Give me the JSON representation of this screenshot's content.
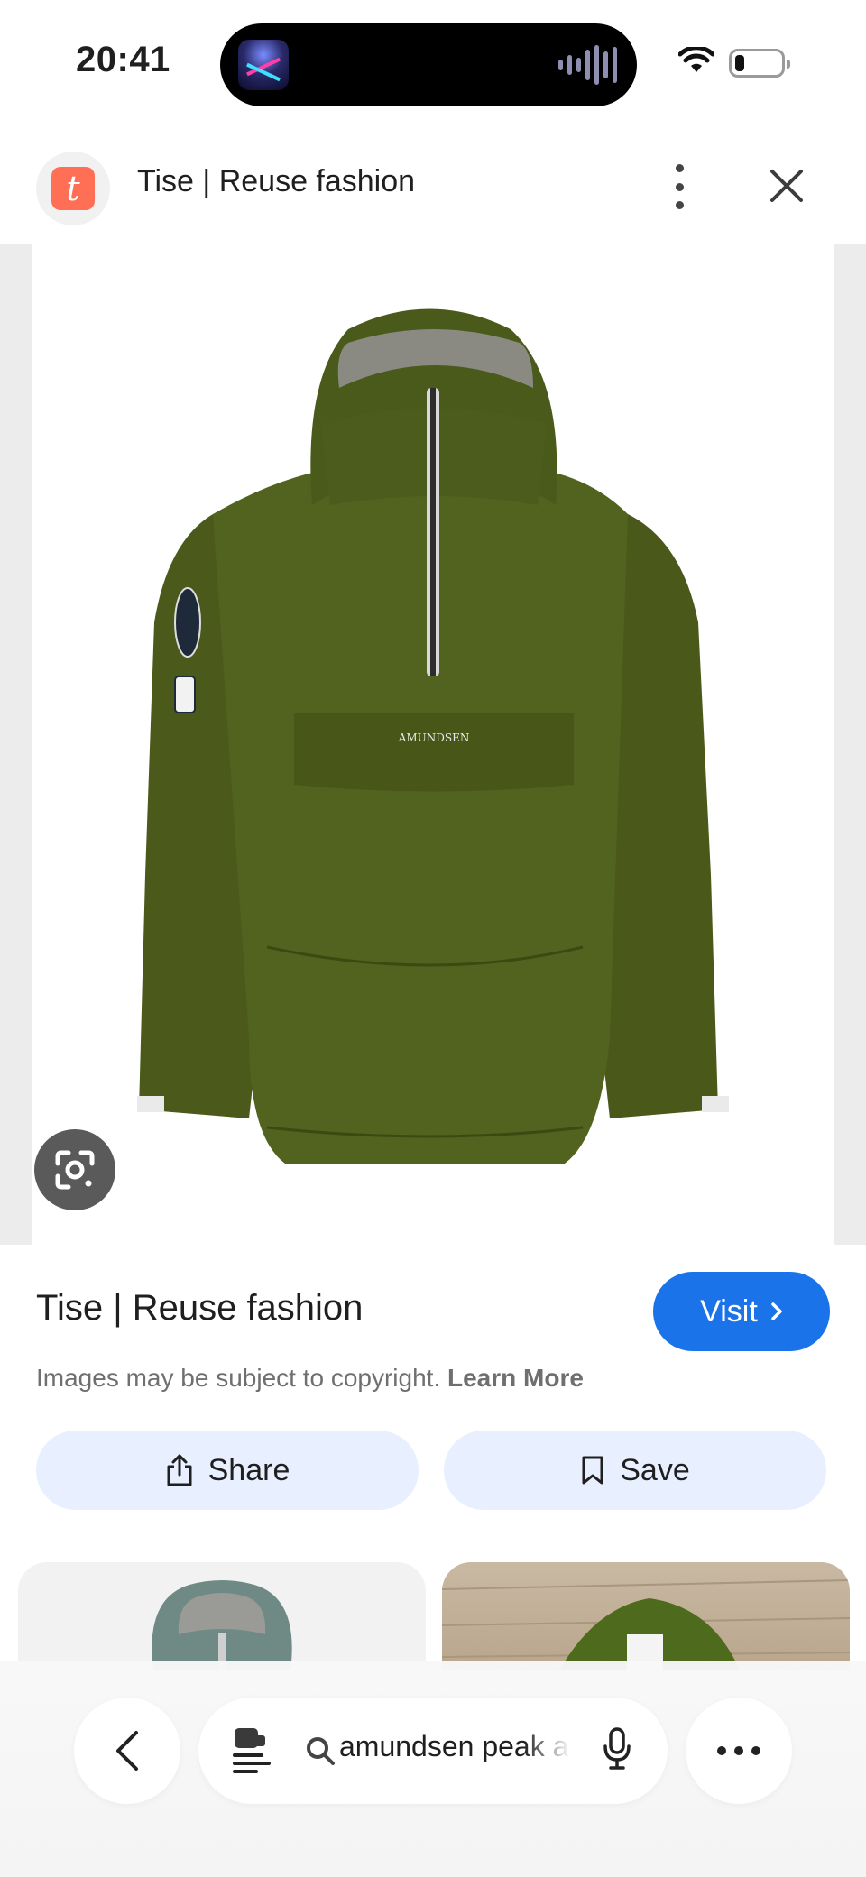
{
  "status_bar": {
    "time": "20:41"
  },
  "header": {
    "site_logo_letter": "t",
    "title": "Tise | Reuse fashion",
    "menu_icon": "more-vert-icon",
    "close_icon": "close-icon"
  },
  "image": {
    "logo_text": "AMUNDSEN",
    "jacket_color": "#4b5a1b",
    "lens_icon": "google-lens-icon"
  },
  "result": {
    "title": "Tise | Reuse fashion",
    "visit_label": "Visit",
    "copyright_text": "Images may be subject to copyright.",
    "learn_more_label": "Learn More"
  },
  "actions": {
    "share_label": "Share",
    "save_label": "Save"
  },
  "bottom_bar": {
    "search_query": "amundsen peak a"
  },
  "colors": {
    "accent": "#1a73e8",
    "pill_background": "#e8efff",
    "site_brand": "#ff6f55"
  }
}
